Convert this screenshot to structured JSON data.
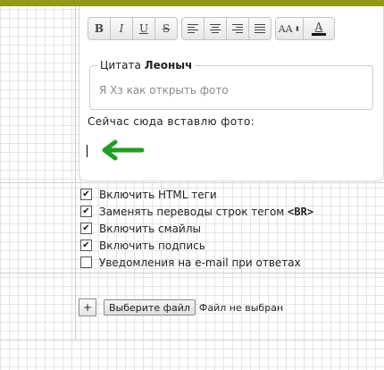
{
  "colors": {
    "top_bar": "#8f9a1b",
    "arrow": "#1f9d22"
  },
  "toolbar": {
    "bold_label": "B",
    "italic_label": "I",
    "underline_label": "U",
    "strike_label": "S",
    "font_size_label": "AA",
    "font_color_label": "A",
    "icons": [
      "align-left-icon",
      "align-center-icon",
      "align-right-icon",
      "align-justify-icon",
      "dropdown-arrows-icon"
    ]
  },
  "editor": {
    "quote_label": "Цитата",
    "quote_author": "Леоныч",
    "quote_text": "Я Хз как открыть фото",
    "message_text": "Сейчас сюда вставлю фото:"
  },
  "options": [
    {
      "label": "Включить HTML теги",
      "checked": true
    },
    {
      "label": "Заменять переводы строк тегом ",
      "code": "<BR>",
      "checked": true
    },
    {
      "label": "Включить смайлы",
      "checked": true
    },
    {
      "label": "Включить подпись",
      "checked": true
    },
    {
      "label": "Уведомления на e-mail при ответах",
      "checked": false
    }
  ],
  "attach": {
    "plus_label": "+",
    "choose_label": "Выберите файл",
    "no_file_label": "Файл не выбран"
  }
}
